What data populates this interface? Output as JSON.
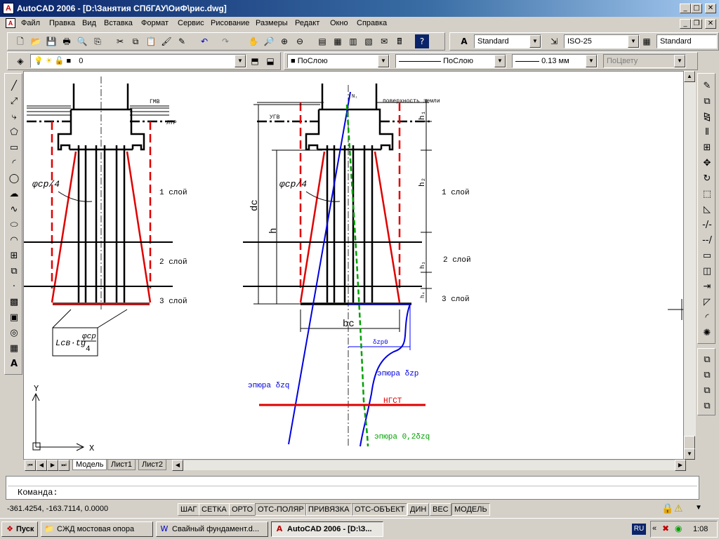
{
  "window": {
    "title": "AutoCAD 2006 - [D:\\Занятия СПбГАУ\\ОиФ\\рис.dwg]",
    "app_icon": "autocad-logo-icon",
    "controls": [
      "_",
      "□",
      "X"
    ]
  },
  "menu": [
    "Файл",
    "Правка",
    "Вид",
    "Вставка",
    "Формат",
    "Сервис",
    "Рисование",
    "Размеры",
    "Редакт",
    "Окно",
    "Справка"
  ],
  "styles_toolbar": {
    "text_style": "Standard",
    "dim_style": "ISO-25",
    "table_style": "Standard"
  },
  "layers_toolbar": {
    "current_layer": "0",
    "color": "ПоСлою",
    "linetype": "ПоСлою",
    "lineweight": "0.13 мм",
    "plot_style": "ПоЦвету"
  },
  "drawing": {
    "left_labels": {
      "gwl": "ГМВ",
      "ltr": "ЛТР",
      "phi": "φср/4",
      "layer1": "1 слой",
      "layer2": "2 слой",
      "layer3": "3 слой",
      "formula_l": "Lсв·tg",
      "formula_phi": "φср",
      "formula_4": "4"
    },
    "right_labels": {
      "n": "N₁",
      "surface": "поверхность земли",
      "ugv": "УГВ",
      "phi": "φср/4",
      "dc": "dc",
      "h": "h",
      "h1": "h₁",
      "h2": "h₂",
      "h3": "h₃",
      "h4": "h₄",
      "layer1": "1 слой",
      "layer2": "2 слой",
      "layer3": "3 слой",
      "bc": "bc",
      "szp0": "δzp0",
      "epure_szp": "эпюра δzp",
      "epure_szq": "эпюра δzq",
      "ngst": "НГСТ",
      "epure_02": "эпюра 0,2δzq"
    },
    "axes": {
      "y": "Y",
      "x": "X"
    }
  },
  "tabs": [
    "Модель",
    "Лист1",
    "Лист2"
  ],
  "active_tab": "Модель",
  "command": {
    "prompt": "Команда:"
  },
  "status": {
    "coords": "-361.4254, -163.7114, 0.0000",
    "toggles": [
      "ШАГ",
      "СЕТКА",
      "ОРТО",
      "ОТС-ПОЛЯР",
      "ПРИВЯЗКА",
      "ОТС-ОБЪЕКТ",
      "ДИН",
      "ВЕС",
      "МОДЕЛЬ"
    ],
    "toggles_on": [
      "ОТС-ПОЛЯР",
      "ПРИВЯЗКА",
      "ОТС-ОБЪЕКТ",
      "МОДЕЛЬ"
    ]
  },
  "taskbar": {
    "start": "Пуск",
    "tasks": [
      "СЖД мостовая опора",
      "Свайный фундамент.d...",
      "AutoCAD 2006 - [D:\\З..."
    ],
    "active_task": 2,
    "lang": "RU",
    "clock": "1:08"
  }
}
